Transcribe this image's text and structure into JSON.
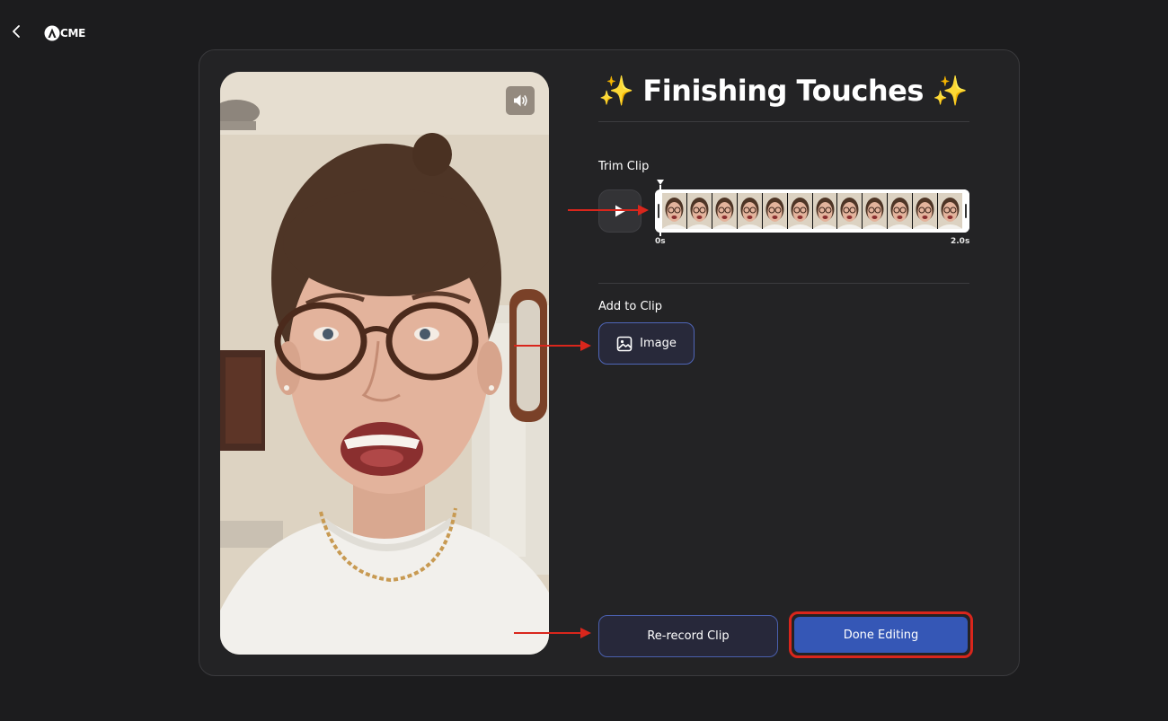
{
  "header": {
    "back_icon": "chevron-left-icon",
    "logo_text": "CME",
    "logo_icon": "acme-a-logo"
  },
  "video_preview": {
    "mute_icon": "speaker-volume-icon"
  },
  "editor": {
    "title": "Finishing Touches",
    "title_emoji": "✨",
    "trim_section": {
      "label": "Trim Clip",
      "play_icon": "play-icon",
      "start_time": "0s",
      "end_time": "2.0s",
      "frame_count": 12
    },
    "add_section": {
      "label": "Add to Clip",
      "image_button_label": "Image",
      "image_button_icon": "image-icon"
    },
    "actions": {
      "rerecord_label": "Re-record Clip",
      "done_label": "Done Editing"
    }
  },
  "colors": {
    "background": "#1c1c1e",
    "card": "#232325",
    "primary_button": "#3557b6",
    "outline_button_border": "#4a5fad",
    "annotation_red": "#d9261c"
  }
}
